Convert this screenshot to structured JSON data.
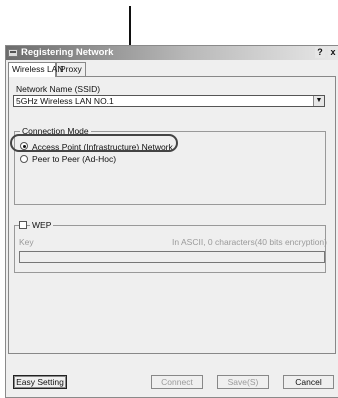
{
  "window": {
    "title": "Registering Network",
    "help_label": "?",
    "close_label": "x"
  },
  "tabs": [
    {
      "label": "Wireless LAN"
    },
    {
      "label": "Proxy"
    }
  ],
  "ssid": {
    "label": "Network Name (SSID)",
    "value": "5GHz Wireless LAN NO.1"
  },
  "connection_mode": {
    "title": "Connection Mode",
    "options": [
      {
        "label": "Access Point (Infrastructure) Network",
        "selected": true
      },
      {
        "label": "Peer to Peer (Ad-Hoc)",
        "selected": false
      }
    ]
  },
  "wep": {
    "label": "WEP",
    "key_label": "Key",
    "key_info": "In ASCII, 0 characters(40 bits encryption)",
    "key_value": ""
  },
  "buttons": {
    "easy_setting": "Easy Setting",
    "connect": "Connect",
    "save": "Save(S)",
    "cancel": "Cancel"
  }
}
